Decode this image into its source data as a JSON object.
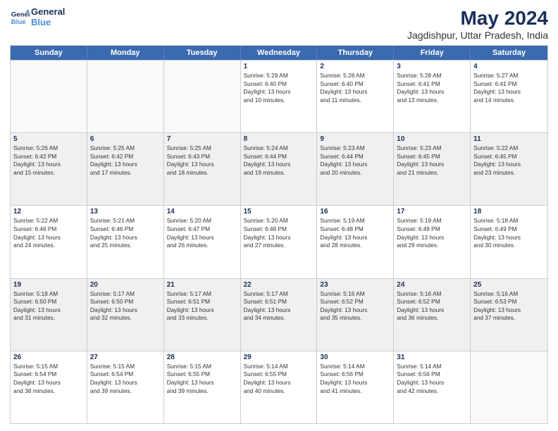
{
  "logo": {
    "line1": "General",
    "line2": "Blue"
  },
  "title": "May 2024",
  "subtitle": "Jagdishpur, Uttar Pradesh, India",
  "weekdays": [
    "Sunday",
    "Monday",
    "Tuesday",
    "Wednesday",
    "Thursday",
    "Friday",
    "Saturday"
  ],
  "weeks": [
    [
      {
        "day": "",
        "lines": []
      },
      {
        "day": "",
        "lines": []
      },
      {
        "day": "",
        "lines": []
      },
      {
        "day": "1",
        "lines": [
          "Sunrise: 5:29 AM",
          "Sunset: 6:40 PM",
          "Daylight: 13 hours",
          "and 10 minutes."
        ]
      },
      {
        "day": "2",
        "lines": [
          "Sunrise: 5:28 AM",
          "Sunset: 6:40 PM",
          "Daylight: 13 hours",
          "and 11 minutes."
        ]
      },
      {
        "day": "3",
        "lines": [
          "Sunrise: 5:28 AM",
          "Sunset: 6:41 PM",
          "Daylight: 13 hours",
          "and 13 minutes."
        ]
      },
      {
        "day": "4",
        "lines": [
          "Sunrise: 5:27 AM",
          "Sunset: 6:41 PM",
          "Daylight: 13 hours",
          "and 14 minutes."
        ]
      }
    ],
    [
      {
        "day": "5",
        "lines": [
          "Sunrise: 5:26 AM",
          "Sunset: 6:42 PM",
          "Daylight: 13 hours",
          "and 15 minutes."
        ]
      },
      {
        "day": "6",
        "lines": [
          "Sunrise: 5:25 AM",
          "Sunset: 6:42 PM",
          "Daylight: 13 hours",
          "and 17 minutes."
        ]
      },
      {
        "day": "7",
        "lines": [
          "Sunrise: 5:25 AM",
          "Sunset: 6:43 PM",
          "Daylight: 13 hours",
          "and 18 minutes."
        ]
      },
      {
        "day": "8",
        "lines": [
          "Sunrise: 5:24 AM",
          "Sunset: 6:44 PM",
          "Daylight: 13 hours",
          "and 19 minutes."
        ]
      },
      {
        "day": "9",
        "lines": [
          "Sunrise: 5:23 AM",
          "Sunset: 6:44 PM",
          "Daylight: 13 hours",
          "and 20 minutes."
        ]
      },
      {
        "day": "10",
        "lines": [
          "Sunrise: 5:23 AM",
          "Sunset: 6:45 PM",
          "Daylight: 13 hours",
          "and 21 minutes."
        ]
      },
      {
        "day": "11",
        "lines": [
          "Sunrise: 5:22 AM",
          "Sunset: 6:45 PM",
          "Daylight: 13 hours",
          "and 23 minutes."
        ]
      }
    ],
    [
      {
        "day": "12",
        "lines": [
          "Sunrise: 5:22 AM",
          "Sunset: 6:46 PM",
          "Daylight: 13 hours",
          "and 24 minutes."
        ]
      },
      {
        "day": "13",
        "lines": [
          "Sunrise: 5:21 AM",
          "Sunset: 6:46 PM",
          "Daylight: 13 hours",
          "and 25 minutes."
        ]
      },
      {
        "day": "14",
        "lines": [
          "Sunrise: 5:20 AM",
          "Sunset: 6:47 PM",
          "Daylight: 13 hours",
          "and 26 minutes."
        ]
      },
      {
        "day": "15",
        "lines": [
          "Sunrise: 5:20 AM",
          "Sunset: 6:48 PM",
          "Daylight: 13 hours",
          "and 27 minutes."
        ]
      },
      {
        "day": "16",
        "lines": [
          "Sunrise: 5:19 AM",
          "Sunset: 6:48 PM",
          "Daylight: 13 hours",
          "and 28 minutes."
        ]
      },
      {
        "day": "17",
        "lines": [
          "Sunrise: 5:19 AM",
          "Sunset: 6:49 PM",
          "Daylight: 13 hours",
          "and 29 minutes."
        ]
      },
      {
        "day": "18",
        "lines": [
          "Sunrise: 5:18 AM",
          "Sunset: 6:49 PM",
          "Daylight: 13 hours",
          "and 30 minutes."
        ]
      }
    ],
    [
      {
        "day": "19",
        "lines": [
          "Sunrise: 5:18 AM",
          "Sunset: 6:50 PM",
          "Daylight: 13 hours",
          "and 31 minutes."
        ]
      },
      {
        "day": "20",
        "lines": [
          "Sunrise: 5:17 AM",
          "Sunset: 6:50 PM",
          "Daylight: 13 hours",
          "and 32 minutes."
        ]
      },
      {
        "day": "21",
        "lines": [
          "Sunrise: 5:17 AM",
          "Sunset: 6:51 PM",
          "Daylight: 13 hours",
          "and 33 minutes."
        ]
      },
      {
        "day": "22",
        "lines": [
          "Sunrise: 5:17 AM",
          "Sunset: 6:51 PM",
          "Daylight: 13 hours",
          "and 34 minutes."
        ]
      },
      {
        "day": "23",
        "lines": [
          "Sunrise: 5:16 AM",
          "Sunset: 6:52 PM",
          "Daylight: 13 hours",
          "and 35 minutes."
        ]
      },
      {
        "day": "24",
        "lines": [
          "Sunrise: 5:16 AM",
          "Sunset: 6:52 PM",
          "Daylight: 13 hours",
          "and 36 minutes."
        ]
      },
      {
        "day": "25",
        "lines": [
          "Sunrise: 5:16 AM",
          "Sunset: 6:53 PM",
          "Daylight: 13 hours",
          "and 37 minutes."
        ]
      }
    ],
    [
      {
        "day": "26",
        "lines": [
          "Sunrise: 5:15 AM",
          "Sunset: 6:54 PM",
          "Daylight: 13 hours",
          "and 38 minutes."
        ]
      },
      {
        "day": "27",
        "lines": [
          "Sunrise: 5:15 AM",
          "Sunset: 6:54 PM",
          "Daylight: 13 hours",
          "and 39 minutes."
        ]
      },
      {
        "day": "28",
        "lines": [
          "Sunrise: 5:15 AM",
          "Sunset: 6:55 PM",
          "Daylight: 13 hours",
          "and 39 minutes."
        ]
      },
      {
        "day": "29",
        "lines": [
          "Sunrise: 5:14 AM",
          "Sunset: 6:55 PM",
          "Daylight: 13 hours",
          "and 40 minutes."
        ]
      },
      {
        "day": "30",
        "lines": [
          "Sunrise: 5:14 AM",
          "Sunset: 6:56 PM",
          "Daylight: 13 hours",
          "and 41 minutes."
        ]
      },
      {
        "day": "31",
        "lines": [
          "Sunrise: 5:14 AM",
          "Sunset: 6:56 PM",
          "Daylight: 13 hours",
          "and 42 minutes."
        ]
      },
      {
        "day": "",
        "lines": []
      }
    ]
  ]
}
